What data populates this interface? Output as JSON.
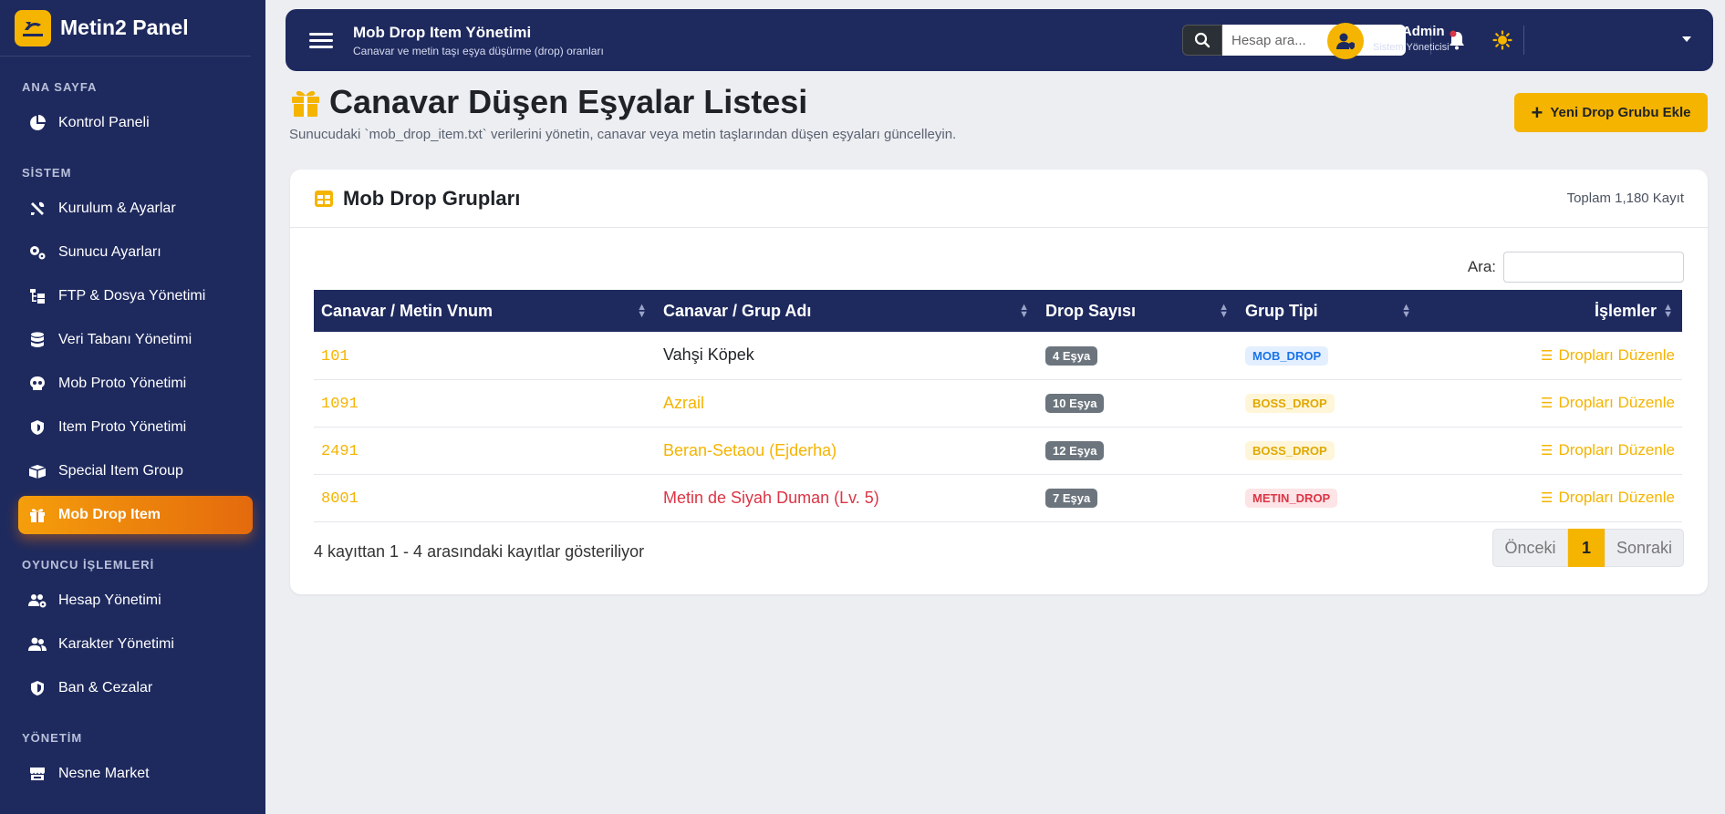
{
  "colors": {
    "sidebar_bg": "#1e2a5e",
    "accent": "#f5b400",
    "active_gradient": [
      "#f59e0b",
      "#e46a0d"
    ],
    "danger": "#dc3545"
  },
  "brand": {
    "name": "Metin2 Panel"
  },
  "sidebar": {
    "sections": [
      {
        "label": "ANA SAYFA",
        "items": [
          {
            "label": "Kontrol Paneli",
            "icon": "pie-chart-icon"
          }
        ]
      },
      {
        "label": "SİSTEM",
        "items": [
          {
            "label": "Kurulum & Ayarlar",
            "icon": "tools-icon"
          },
          {
            "label": "Sunucu Ayarları",
            "icon": "gears-icon"
          },
          {
            "label": "FTP & Dosya Yönetimi",
            "icon": "folder-tree-icon"
          },
          {
            "label": "Veri Tabanı Yönetimi",
            "icon": "database-icon"
          },
          {
            "label": "Mob Proto Yönetimi",
            "icon": "skull-icon"
          },
          {
            "label": "Item Proto Yönetimi",
            "icon": "shield-icon"
          },
          {
            "label": "Special Item Group",
            "icon": "boxes-icon"
          },
          {
            "label": "Mob Drop Item",
            "icon": "gift-icon",
            "active": true
          }
        ]
      },
      {
        "label": "OYUNCU İŞLEMLERİ",
        "items": [
          {
            "label": "Hesap Yönetimi",
            "icon": "users-cog-icon"
          },
          {
            "label": "Karakter Yönetimi",
            "icon": "user-friends-icon"
          },
          {
            "label": "Ban & Cezalar",
            "icon": "ban-shield-icon"
          }
        ]
      },
      {
        "label": "YÖNETİM",
        "items": [
          {
            "label": "Nesne Market",
            "icon": "store-icon"
          }
        ]
      }
    ]
  },
  "topbar": {
    "title": "Mob Drop Item Yönetimi",
    "subtitle": "Canavar ve metin taşı eşya düşürme (drop) oranları",
    "search_placeholder": "Hesap ara...",
    "user_name": "[TL] Admin",
    "user_role": "Sistem Yöneticisi"
  },
  "page": {
    "title": "Canavar Düşen Eşyalar Listesi",
    "description": "Sunucudaki `mob_drop_item.txt` verilerini yönetin, canavar veya metin taşlarından düşen eşyaları güncelleyin.",
    "add_button": "Yeni Drop Grubu Ekle"
  },
  "card": {
    "title": "Mob Drop Grupları",
    "count_label": "Toplam 1,180 Kayıt",
    "filter_label": "Ara:",
    "columns": [
      "Canavar / Metin Vnum",
      "Canavar / Grup Adı",
      "Drop Sayısı",
      "Grup Tipi",
      "İşlemler"
    ],
    "rows": [
      {
        "vnum": "101",
        "name": "Vahşi Köpek",
        "name_color": "#212529",
        "count": "4 Eşya",
        "type": "MOB_DROP",
        "type_fg": "#1a73e8",
        "type_bg": "#e3efff",
        "action": "Dropları Düzenle"
      },
      {
        "vnum": "1091",
        "name": "Azrail",
        "name_color": "#f5b400",
        "count": "10 Eşya",
        "type": "BOSS_DROP",
        "type_fg": "#e0a800",
        "type_bg": "#fff6d9",
        "action": "Dropları Düzenle"
      },
      {
        "vnum": "2491",
        "name": "Beran-Setaou (Ejderha)",
        "name_color": "#f5b400",
        "count": "12 Eşya",
        "type": "BOSS_DROP",
        "type_fg": "#e0a800",
        "type_bg": "#fff6d9",
        "action": "Dropları Düzenle"
      },
      {
        "vnum": "8001",
        "name": "Metin de Siyah Duman (Lv. 5)",
        "name_color": "#dc3545",
        "count": "7 Eşya",
        "type": "METIN_DROP",
        "type_fg": "#dc3545",
        "type_bg": "#fde4e6",
        "action": "Dropları Düzenle"
      }
    ],
    "info": "4 kayıttan 1 - 4 arasındaki kayıtlar gösteriliyor",
    "pager": {
      "prev": "Önceki",
      "current": "1",
      "next": "Sonraki"
    }
  }
}
